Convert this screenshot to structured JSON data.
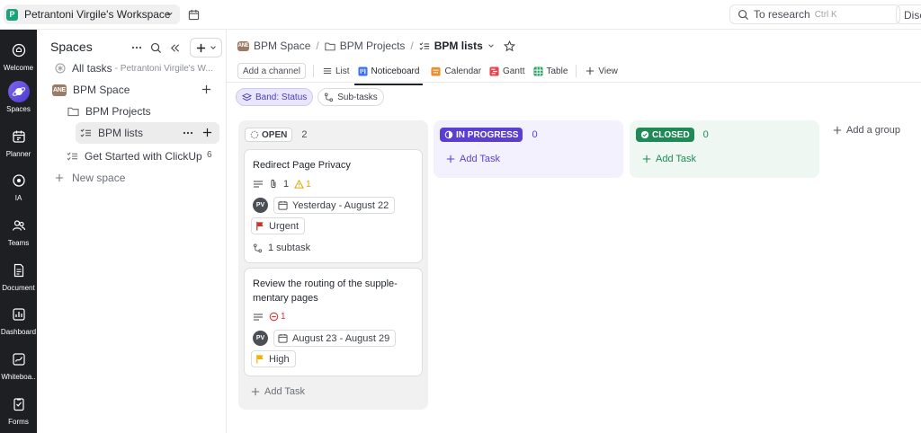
{
  "topbar": {
    "workspace_initial": "P",
    "workspace_name": "Petrantoni Virgile's Workspace",
    "search_placeholder": "To research",
    "search_shortcut": "Ctrl K",
    "discover_label": "Disc"
  },
  "rail": [
    {
      "label": "Welcome",
      "icon": "home-icon"
    },
    {
      "label": "Spaces",
      "icon": "planet-icon"
    },
    {
      "label": "Planner",
      "icon": "calendar-icon"
    },
    {
      "label": "IA",
      "icon": "ai-icon"
    },
    {
      "label": "Teams",
      "icon": "teams-icon"
    },
    {
      "label": "Document",
      "icon": "document-icon"
    },
    {
      "label": "Dashboard",
      "icon": "dashboard-icon"
    },
    {
      "label": "Whiteboa..",
      "icon": "whiteboard-icon"
    },
    {
      "label": "Forms",
      "icon": "forms-icon"
    }
  ],
  "sidebar": {
    "title": "Spaces",
    "all_tasks": "All tasks",
    "all_tasks_sub": "- Petrantoni Virgile's W...",
    "space_badge": "ANE",
    "space_name": "BPM Space",
    "folder_name": "BPM Projects",
    "list_name": "BPM lists",
    "get_started": "Get Started with ClickUp",
    "get_started_count": "6",
    "new_space": "New space"
  },
  "breadcrumb": {
    "space": "BPM Space",
    "folder": "BPM Projects",
    "list": "BPM lists"
  },
  "views": {
    "add_channel": "Add a channel",
    "list": "List",
    "noticeboard": "Noticeboard",
    "calendar": "Calendar",
    "gantt": "Gantt",
    "table": "Table",
    "add_view": "View"
  },
  "chips": {
    "band": "Band: Status",
    "subtasks": "Sub-tasks"
  },
  "board": {
    "open": {
      "label": "OPEN",
      "count": "2",
      "add_task": "Add Task",
      "cards": [
        {
          "title": "Redirect Page Privacy",
          "attachments": "1",
          "warnings": "1",
          "assignee": "PV",
          "dates": "Yesterday - August 22",
          "priority": "Urgent",
          "subtasks": "1 subtask"
        },
        {
          "title": "Review the routing of the supple-mentary pages",
          "blocked": "1",
          "assignee": "PV",
          "dates": "August 23 - August 29",
          "priority": "High"
        }
      ]
    },
    "in_progress": {
      "label": "IN PROGRESS",
      "count": "0",
      "add_task": "Add Task"
    },
    "closed": {
      "label": "CLOSED",
      "count": "0",
      "add_task": "Add Task"
    },
    "add_group": "Add a group"
  },
  "colors": {
    "in_progress": "#5b3fd1",
    "closed": "#1f8a55",
    "urgent_flag": "#d42b2b",
    "high_flag": "#f5b000"
  }
}
